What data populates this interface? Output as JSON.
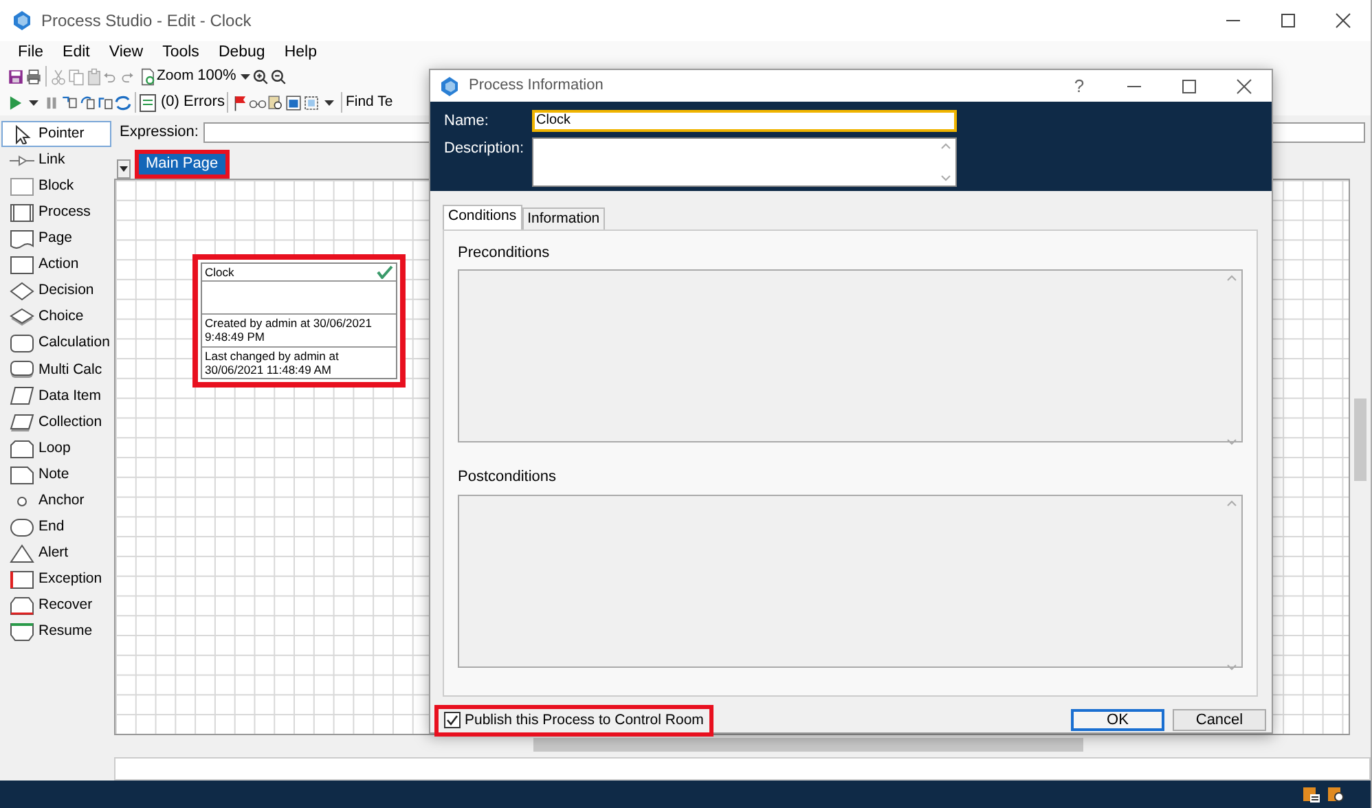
{
  "window": {
    "title": "Process Studio  - Edit - Clock"
  },
  "menu": [
    "File",
    "Edit",
    "View",
    "Tools",
    "Debug",
    "Help"
  ],
  "toolbar": {
    "zoom_label": "Zoom",
    "zoom_value": "100%",
    "errors": "(0) Errors",
    "find": "Find Te"
  },
  "palette": [
    {
      "kind": "pointer",
      "label": "Pointer",
      "selected": true
    },
    {
      "kind": "link",
      "label": "Link",
      "selected": false
    },
    {
      "kind": "block",
      "label": "Block",
      "selected": false
    },
    {
      "kind": "process",
      "label": "Process",
      "selected": false
    },
    {
      "kind": "page",
      "label": "Page",
      "selected": false
    },
    {
      "kind": "action",
      "label": "Action",
      "selected": false
    },
    {
      "kind": "decision",
      "label": "Decision",
      "selected": false
    },
    {
      "kind": "choice",
      "label": "Choice",
      "selected": false
    },
    {
      "kind": "calculation",
      "label": "Calculation",
      "selected": false
    },
    {
      "kind": "multicalc",
      "label": "Multi Calc",
      "selected": false
    },
    {
      "kind": "dataitem",
      "label": "Data Item",
      "selected": false
    },
    {
      "kind": "collection",
      "label": "Collection",
      "selected": false
    },
    {
      "kind": "loop",
      "label": "Loop",
      "selected": false
    },
    {
      "kind": "note",
      "label": "Note",
      "selected": false
    },
    {
      "kind": "anchor",
      "label": "Anchor",
      "selected": false
    },
    {
      "kind": "end",
      "label": "End",
      "selected": false
    },
    {
      "kind": "alert",
      "label": "Alert",
      "selected": false
    },
    {
      "kind": "exception",
      "label": "Exception",
      "selected": false
    },
    {
      "kind": "recover",
      "label": "Recover",
      "selected": false
    },
    {
      "kind": "resume",
      "label": "Resume",
      "selected": false
    }
  ],
  "expression": {
    "label": "Expression:"
  },
  "page_tabs": [
    {
      "label": "Main Page",
      "selected": true,
      "highlighted": true
    }
  ],
  "stage": {
    "title": "Clock",
    "created": "Created by admin at 30/06/2021 9:48:49 PM",
    "changed": "Last changed by admin at 30/06/2021 11:48:49 AM",
    "highlighted": true
  },
  "dialog": {
    "title": "Process Information",
    "help": "?",
    "name_label": "Name:",
    "name_value": "Clock",
    "description_label": "Description:",
    "tabs": [
      {
        "label": "Conditions",
        "selected": true
      },
      {
        "label": "Information",
        "selected": false
      }
    ],
    "preconditions_label": "Preconditions",
    "postconditions_label": "Postconditions",
    "publish": {
      "label": "Publish this Process to Control Room",
      "checked": true,
      "highlighted": true
    },
    "buttons": [
      {
        "label": "OK",
        "default": true
      },
      {
        "label": "Cancel",
        "default": false
      }
    ]
  }
}
